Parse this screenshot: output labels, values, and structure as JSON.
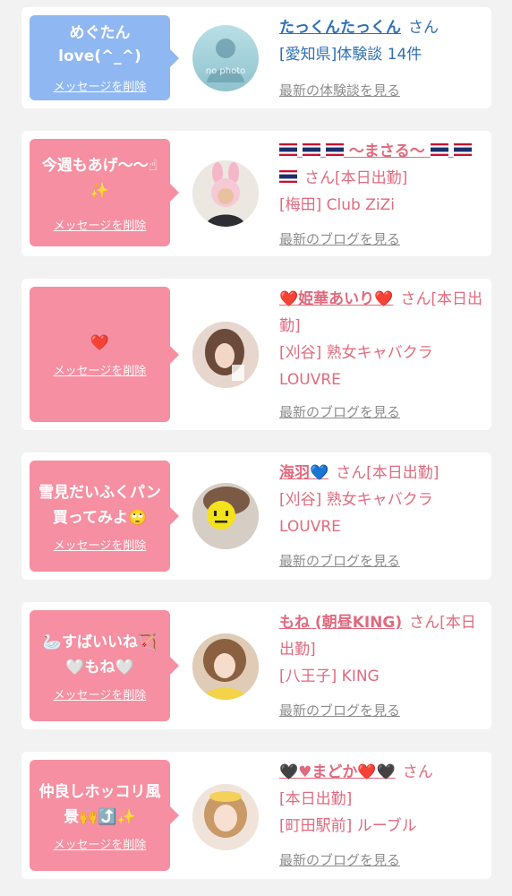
{
  "cards": [
    {
      "bubble_text_1": "めぐたん",
      "bubble_text_2": "love(^_^)",
      "delete_label": "メッセージを削除",
      "name": "たっくんたっくん",
      "suffix": "さん",
      "shop": "[愛知県]体験談 14件",
      "more_label": "最新の体験談を見る",
      "avatar_text": "no photo",
      "bubble_color": "#8fb7f2",
      "accent_color": "#2f6fb5"
    },
    {
      "bubble_text_1": "今週もあげ〜〜☝",
      "bubble_text_2": "✨",
      "delete_label": "メッセージを削除",
      "name_prefix": "〜まさる〜",
      "suffix": "さん[本日出勤]",
      "shop": "[梅田] Club ZiZi",
      "more_label": "最新のブログを見る",
      "bubble_color": "#f58fa1"
    },
    {
      "bubble_text_1": "❤️",
      "delete_label": "メッセージを削除",
      "name": "姫華あいり",
      "suffix": "さん[本日出勤]",
      "shop_1": "[刈谷] 熟女キャバクラ",
      "shop_2": "LOUVRE",
      "more_label": "最新のブログを見る",
      "bubble_color": "#f58fa1"
    },
    {
      "bubble_text_1": "雪見だいふくパン",
      "bubble_text_2": "買ってみよ🙄",
      "delete_label": "メッセージを削除",
      "name": "海羽💙",
      "suffix": "さん[本日出勤]",
      "shop_1": "[刈谷] 熟女キャバクラ",
      "shop_2": "LOUVRE",
      "more_label": "最新のブログを見る",
      "bubble_color": "#f58fa1"
    },
    {
      "bubble_text_1": "🦢すばいいね🏹",
      "bubble_text_2": "🤍もね🤍",
      "delete_label": "メッセージを削除",
      "name": "もね (朝昼KING)",
      "suffix": "さん[本日出勤]",
      "shop": "[八王子] KING",
      "more_label": "最新のブログを見る",
      "bubble_color": "#f58fa1"
    },
    {
      "bubble_text_1": "仲良しホッコリ風",
      "bubble_text_2": "景🙌⤴️✨",
      "delete_label": "メッセージを削除",
      "name": "🖤♥まどか❤️🖤",
      "suffix": "さん",
      "status": "[本日出勤]",
      "shop": "[町田駅前] ルーブル",
      "more_label": "最新のブログを見る",
      "bubble_color": "#f58fa1"
    }
  ]
}
